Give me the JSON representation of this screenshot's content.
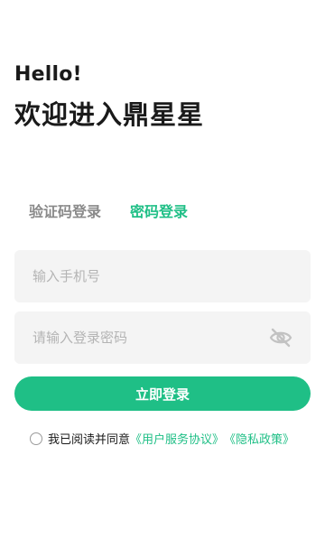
{
  "header": {
    "greeting": "Hello!",
    "welcome": "欢迎进入鼎星星"
  },
  "tabs": [
    {
      "label": "验证码登录",
      "active": false
    },
    {
      "label": "密码登录",
      "active": true
    }
  ],
  "form": {
    "phone_placeholder": "输入手机号",
    "phone_value": "",
    "password_placeholder": "请输入登录密码",
    "password_value": "",
    "toggle_icon": "eye-off-icon"
  },
  "login_button": "立即登录",
  "agreement": {
    "prefix": "我已阅读并同意",
    "service_link": "《用户服务协议》",
    "privacy_link": "《隐私政策》",
    "checked": false
  },
  "colors": {
    "accent": "#1fbf86",
    "field_bg": "#f4f4f4",
    "muted_tab": "#8a8a8a"
  }
}
